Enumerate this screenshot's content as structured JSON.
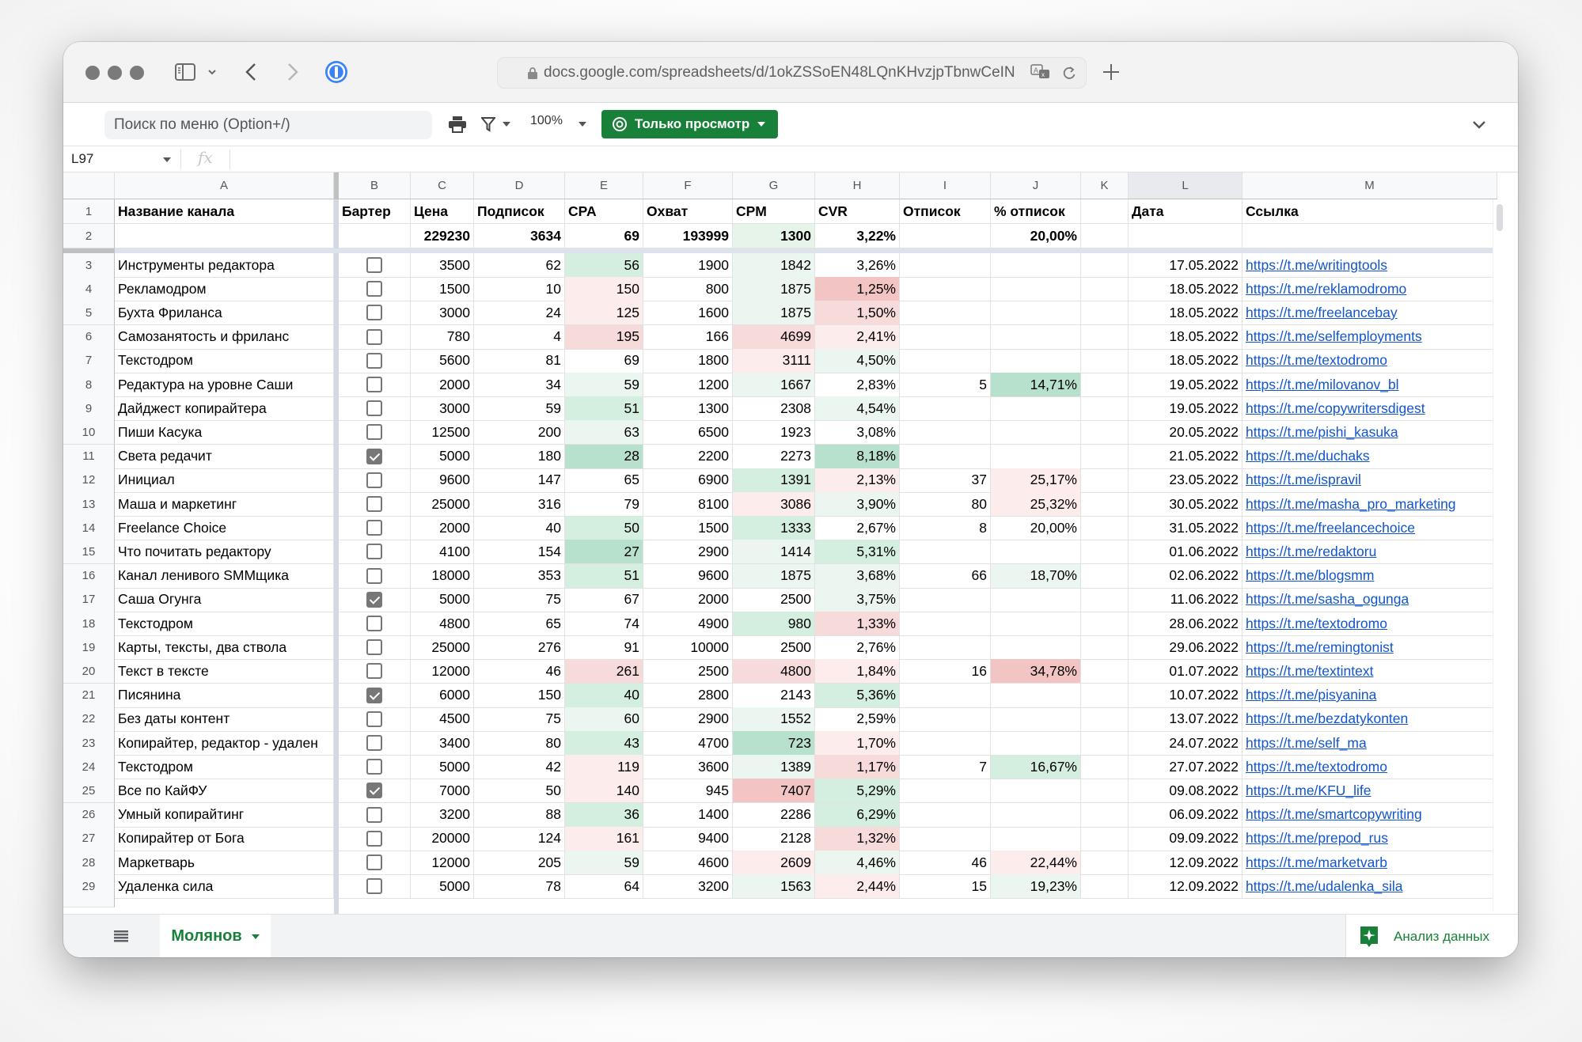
{
  "browser": {
    "url": "docs.google.com/spreadsheets/d/1okZSSoEN48LQnKHvzjpTbnwCeIN",
    "icons": [
      "sidebar-toggle-icon",
      "chevron-down-icon",
      "back-icon",
      "forward-icon",
      "password-manager-icon",
      "lock-icon",
      "translate-icon",
      "reload-icon",
      "new-tab-icon"
    ]
  },
  "toolbar": {
    "menu_search_placeholder": "Поиск по меню (Option+/)",
    "zoom": "100%",
    "view_mode_label": "Только просмотр",
    "accent": "#188038"
  },
  "formula_bar": {
    "cell_ref": "L97",
    "fx": "fx",
    "value": ""
  },
  "columns": [
    "A",
    "B",
    "C",
    "D",
    "E",
    "F",
    "G",
    "H",
    "I",
    "J",
    "K",
    "L",
    "M"
  ],
  "selected_column": "L",
  "header_row": {
    "row": "1",
    "cells": [
      "Название канала",
      "Бартер",
      "Цена",
      "Подписок",
      "CPA",
      "Охват",
      "CPM",
      "CVR",
      "Отписок",
      "% отписок",
      "",
      "Дата",
      "Ссылка"
    ]
  },
  "totals_row": {
    "row": "2",
    "cells": [
      "",
      "",
      "229230",
      "3634",
      "69",
      "193999",
      "1300",
      "3,22%",
      "",
      "20,00%",
      "",
      "",
      ""
    ],
    "colors": {
      "G": "#e6f4ea"
    }
  },
  "colors": {
    "green_strong": "#b7e1cd",
    "green_mid": "#d4eedf",
    "green_light": "#eaf6ef",
    "red_strong": "#f2c4c4",
    "red_mid": "#f7dada",
    "red_light": "#fcecec",
    "link": "#1155cc"
  },
  "rows": [
    {
      "row": "3",
      "name": "Инструменты редактора",
      "barter": false,
      "price": "3500",
      "subs": "62",
      "cpa": "56",
      "reach": "1900",
      "cpm": "1842",
      "cvr": "3,26%",
      "unsubs": "",
      "unsub_pct": "",
      "date": "17.05.2022",
      "link": "https://t.me/writingtools",
      "cpa_c": "gm",
      "cpm_c": "gl",
      "cvr_c": "",
      "up_c": ""
    },
    {
      "row": "4",
      "name": "Рекламодром",
      "barter": false,
      "price": "1500",
      "subs": "10",
      "cpa": "150",
      "reach": "800",
      "cpm": "1875",
      "cvr": "1,25%",
      "unsubs": "",
      "unsub_pct": "",
      "date": "18.05.2022",
      "link": "https://t.me/reklamodromo",
      "cpa_c": "rl",
      "cpm_c": "gl",
      "cvr_c": "rs",
      "up_c": ""
    },
    {
      "row": "5",
      "name": "Бухта Фриланса",
      "barter": false,
      "price": "3000",
      "subs": "24",
      "cpa": "125",
      "reach": "1600",
      "cpm": "1875",
      "cvr": "1,50%",
      "unsubs": "",
      "unsub_pct": "",
      "date": "18.05.2022",
      "link": "https://t.me/freelancebay",
      "cpa_c": "rl",
      "cpm_c": "gl",
      "cvr_c": "rm",
      "up_c": ""
    },
    {
      "row": "6",
      "name": "Самозанятость и фриланс",
      "barter": false,
      "price": "780",
      "subs": "4",
      "cpa": "195",
      "reach": "166",
      "cpm": "4699",
      "cvr": "2,41%",
      "unsubs": "",
      "unsub_pct": "",
      "date": "18.05.2022",
      "link": "https://t.me/selfemployments",
      "cpa_c": "rm",
      "cpm_c": "rm",
      "cvr_c": "rl",
      "up_c": ""
    },
    {
      "row": "7",
      "name": "Текстодром",
      "barter": false,
      "price": "5600",
      "subs": "81",
      "cpa": "69",
      "reach": "1800",
      "cpm": "3111",
      "cvr": "4,50%",
      "unsubs": "",
      "unsub_pct": "",
      "date": "18.05.2022",
      "link": "https://t.me/textodromo",
      "cpa_c": "",
      "cpm_c": "rl",
      "cvr_c": "gl",
      "up_c": ""
    },
    {
      "row": "8",
      "name": "Редактура на уровне Саши",
      "barter": false,
      "price": "2000",
      "subs": "34",
      "cpa": "59",
      "reach": "1200",
      "cpm": "1667",
      "cvr": "2,83%",
      "unsubs": "5",
      "unsub_pct": "14,71%",
      "date": "19.05.2022",
      "link": "https://t.me/milovanov_bl",
      "cpa_c": "gl",
      "cpm_c": "gl",
      "cvr_c": "",
      "up_c": "gs"
    },
    {
      "row": "9",
      "name": "Дайджест копирайтера",
      "barter": false,
      "price": "3000",
      "subs": "59",
      "cpa": "51",
      "reach": "1300",
      "cpm": "2308",
      "cvr": "4,54%",
      "unsubs": "",
      "unsub_pct": "",
      "date": "19.05.2022",
      "link": "https://t.me/copywritersdigest",
      "cpa_c": "gm",
      "cpm_c": "",
      "cvr_c": "gl",
      "up_c": ""
    },
    {
      "row": "10",
      "name": "Пиши Касука",
      "barter": false,
      "price": "12500",
      "subs": "200",
      "cpa": "63",
      "reach": "6500",
      "cpm": "1923",
      "cvr": "3,08%",
      "unsubs": "",
      "unsub_pct": "",
      "date": "20.05.2022",
      "link": "https://t.me/pishi_kasuka",
      "cpa_c": "gl",
      "cpm_c": "",
      "cvr_c": "",
      "up_c": ""
    },
    {
      "row": "11",
      "name": "Света редачит",
      "barter": true,
      "price": "5000",
      "subs": "180",
      "cpa": "28",
      "reach": "2200",
      "cpm": "2273",
      "cvr": "8,18%",
      "unsubs": "",
      "unsub_pct": "",
      "date": "21.05.2022",
      "link": "https://t.me/duchaks",
      "cpa_c": "gs",
      "cpm_c": "",
      "cvr_c": "gs",
      "up_c": ""
    },
    {
      "row": "12",
      "name": "Инициал",
      "barter": false,
      "price": "9600",
      "subs": "147",
      "cpa": "65",
      "reach": "6900",
      "cpm": "1391",
      "cvr": "2,13%",
      "unsubs": "37",
      "unsub_pct": "25,17%",
      "date": "23.05.2022",
      "link": "https://t.me/ispravil",
      "cpa_c": "",
      "cpm_c": "gm",
      "cvr_c": "rl",
      "up_c": "rl"
    },
    {
      "row": "13",
      "name": "Маша и маркетинг",
      "barter": false,
      "price": "25000",
      "subs": "316",
      "cpa": "79",
      "reach": "8100",
      "cpm": "3086",
      "cvr": "3,90%",
      "unsubs": "80",
      "unsub_pct": "25,32%",
      "date": "30.05.2022",
      "link": "https://t.me/masha_pro_marketing",
      "cpa_c": "",
      "cpm_c": "rl",
      "cvr_c": "gl",
      "up_c": "rl"
    },
    {
      "row": "14",
      "name": "Freelance Choice",
      "barter": false,
      "price": "2000",
      "subs": "40",
      "cpa": "50",
      "reach": "1500",
      "cpm": "1333",
      "cvr": "2,67%",
      "unsubs": "8",
      "unsub_pct": "20,00%",
      "date": "31.05.2022",
      "link": "https://t.me/freelancechoice",
      "cpa_c": "gm",
      "cpm_c": "gm",
      "cvr_c": "",
      "up_c": ""
    },
    {
      "row": "15",
      "name": "Что почитать редактору",
      "barter": false,
      "price": "4100",
      "subs": "154",
      "cpa": "27",
      "reach": "2900",
      "cpm": "1414",
      "cvr": "5,31%",
      "unsubs": "",
      "unsub_pct": "",
      "date": "01.06.2022",
      "link": "https://t.me/redaktoru",
      "cpa_c": "gs",
      "cpm_c": "gl",
      "cvr_c": "gm",
      "up_c": ""
    },
    {
      "row": "16",
      "name": "Канал ленивого SMMщика",
      "barter": false,
      "price": "18000",
      "subs": "353",
      "cpa": "51",
      "reach": "9600",
      "cpm": "1875",
      "cvr": "3,68%",
      "unsubs": "66",
      "unsub_pct": "18,70%",
      "date": "02.06.2022",
      "link": "https://t.me/blogsmm",
      "cpa_c": "gm",
      "cpm_c": "gl",
      "cvr_c": "gl",
      "up_c": "gl"
    },
    {
      "row": "17",
      "name": "Саша Огунга",
      "barter": true,
      "price": "5000",
      "subs": "75",
      "cpa": "67",
      "reach": "2000",
      "cpm": "2500",
      "cvr": "3,75%",
      "unsubs": "",
      "unsub_pct": "",
      "date": "11.06.2022",
      "link": "https://t.me/sasha_ogunga",
      "cpa_c": "",
      "cpm_c": "",
      "cvr_c": "gl",
      "up_c": ""
    },
    {
      "row": "18",
      "name": "Текстодром",
      "barter": false,
      "price": "4800",
      "subs": "65",
      "cpa": "74",
      "reach": "4900",
      "cpm": "980",
      "cvr": "1,33%",
      "unsubs": "",
      "unsub_pct": "",
      "date": "28.06.2022",
      "link": "https://t.me/textodromo",
      "cpa_c": "",
      "cpm_c": "gm",
      "cvr_c": "rm",
      "up_c": ""
    },
    {
      "row": "19",
      "name": "Карты, тексты, два ствола",
      "barter": false,
      "price": "25000",
      "subs": "276",
      "cpa": "91",
      "reach": "10000",
      "cpm": "2500",
      "cvr": "2,76%",
      "unsubs": "",
      "unsub_pct": "",
      "date": "29.06.2022",
      "link": "https://t.me/remingtonist",
      "cpa_c": "",
      "cpm_c": "",
      "cvr_c": "",
      "up_c": ""
    },
    {
      "row": "20",
      "name": "Текст в тексте",
      "barter": false,
      "price": "12000",
      "subs": "46",
      "cpa": "261",
      "reach": "2500",
      "cpm": "4800",
      "cvr": "1,84%",
      "unsubs": "16",
      "unsub_pct": "34,78%",
      "date": "01.07.2022",
      "link": "https://t.me/textintext",
      "cpa_c": "rm",
      "cpm_c": "rm",
      "cvr_c": "rl",
      "up_c": "rs"
    },
    {
      "row": "21",
      "name": "Писянина",
      "barter": true,
      "price": "6000",
      "subs": "150",
      "cpa": "40",
      "reach": "2800",
      "cpm": "2143",
      "cvr": "5,36%",
      "unsubs": "",
      "unsub_pct": "",
      "date": "10.07.2022",
      "link": "https://t.me/pisyanina",
      "cpa_c": "gm",
      "cpm_c": "",
      "cvr_c": "gm",
      "up_c": ""
    },
    {
      "row": "22",
      "name": "Без даты контент",
      "barter": false,
      "price": "4500",
      "subs": "75",
      "cpa": "60",
      "reach": "2900",
      "cpm": "1552",
      "cvr": "2,59%",
      "unsubs": "",
      "unsub_pct": "",
      "date": "13.07.2022",
      "link": "https://t.me/bezdatykonten",
      "cpa_c": "gl",
      "cpm_c": "gl",
      "cvr_c": "",
      "up_c": ""
    },
    {
      "row": "23",
      "name": "Копирайтер, редактор - удален",
      "barter": false,
      "price": "3400",
      "subs": "80",
      "cpa": "43",
      "reach": "4700",
      "cpm": "723",
      "cvr": "1,70%",
      "unsubs": "",
      "unsub_pct": "",
      "date": "24.07.2022",
      "link": "https://t.me/self_ma",
      "cpa_c": "gm",
      "cpm_c": "gs",
      "cvr_c": "rl",
      "up_c": ""
    },
    {
      "row": "24",
      "name": "Текстодром",
      "barter": false,
      "price": "5000",
      "subs": "42",
      "cpa": "119",
      "reach": "3600",
      "cpm": "1389",
      "cvr": "1,17%",
      "unsubs": "7",
      "unsub_pct": "16,67%",
      "date": "27.07.2022",
      "link": "https://t.me/textodromo",
      "cpa_c": "rl",
      "cpm_c": "gl",
      "cvr_c": "rm",
      "up_c": "gm"
    },
    {
      "row": "25",
      "name": "Все по КайФУ",
      "barter": true,
      "price": "7000",
      "subs": "50",
      "cpa": "140",
      "reach": "945",
      "cpm": "7407",
      "cvr": "5,29%",
      "unsubs": "",
      "unsub_pct": "",
      "date": "09.08.2022",
      "link": "https://t.me/KFU_life",
      "cpa_c": "rl",
      "cpm_c": "rs",
      "cvr_c": "gm",
      "up_c": ""
    },
    {
      "row": "26",
      "name": "Умный копирайтинг",
      "barter": false,
      "price": "3200",
      "subs": "88",
      "cpa": "36",
      "reach": "1400",
      "cpm": "2286",
      "cvr": "6,29%",
      "unsubs": "",
      "unsub_pct": "",
      "date": "06.09.2022",
      "link": "https://t.me/smartcopywriting",
      "cpa_c": "gm",
      "cpm_c": "",
      "cvr_c": "gm",
      "up_c": ""
    },
    {
      "row": "27",
      "name": "Копирайтер от Бога",
      "barter": false,
      "price": "20000",
      "subs": "124",
      "cpa": "161",
      "reach": "9400",
      "cpm": "2128",
      "cvr": "1,32%",
      "unsubs": "",
      "unsub_pct": "",
      "date": "09.09.2022",
      "link": "https://t.me/prepod_rus",
      "cpa_c": "rl",
      "cpm_c": "",
      "cvr_c": "rm",
      "up_c": ""
    },
    {
      "row": "28",
      "name": "Маркетварь",
      "barter": false,
      "price": "12000",
      "subs": "205",
      "cpa": "59",
      "reach": "4600",
      "cpm": "2609",
      "cvr": "4,46%",
      "unsubs": "46",
      "unsub_pct": "22,44%",
      "date": "12.09.2022",
      "link": "https://t.me/marketvarb",
      "cpa_c": "gl",
      "cpm_c": "rl",
      "cvr_c": "gl",
      "up_c": "rl"
    },
    {
      "row": "29",
      "name": "Удаленка сила",
      "barter": false,
      "price": "5000",
      "subs": "78",
      "cpa": "64",
      "reach": "3200",
      "cpm": "1563",
      "cvr": "2,44%",
      "unsubs": "15",
      "unsub_pct": "19,23%",
      "date": "12.09.2022",
      "link": "https://t.me/udalenka_sila",
      "cpa_c": "",
      "cpm_c": "gl",
      "cvr_c": "rl",
      "up_c": "gl"
    }
  ],
  "bottom_bar": {
    "sheet_tab": "Молянов",
    "explore_label": "Анализ данных"
  }
}
